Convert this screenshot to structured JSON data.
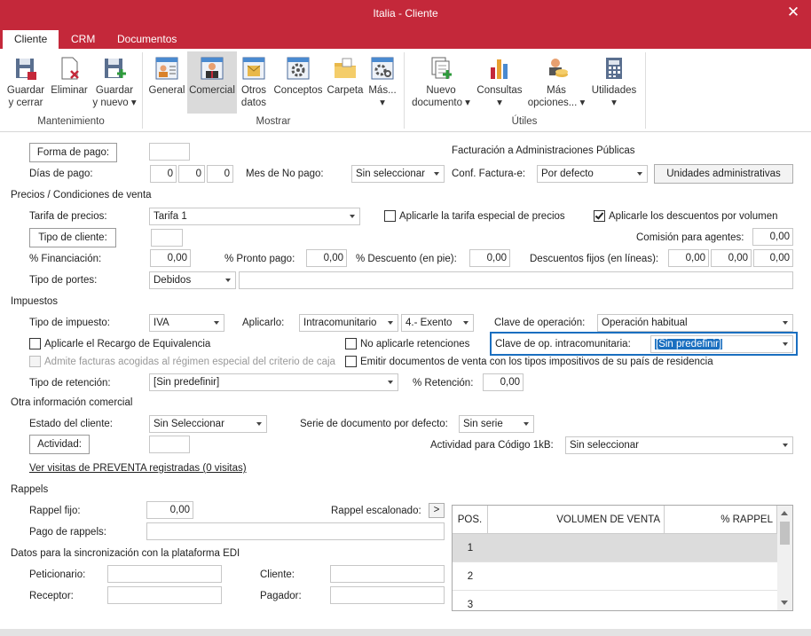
{
  "window": {
    "title": "Italia - Cliente",
    "close_glyph": "✕"
  },
  "tabs": [
    {
      "label": "Cliente",
      "active": true
    },
    {
      "label": "CRM",
      "active": false
    },
    {
      "label": "Documentos",
      "active": false
    }
  ],
  "ribbon": {
    "buttons": {
      "guardar_cerrar": [
        "Guardar",
        "y cerrar"
      ],
      "eliminar": [
        "Eliminar",
        ""
      ],
      "guardar_nuevo": [
        "Guardar",
        "y nuevo ▾"
      ],
      "general": [
        "General",
        ""
      ],
      "comercial": [
        "Comercial",
        ""
      ],
      "otros": [
        "Otros",
        "datos"
      ],
      "conceptos": [
        "Conceptos",
        ""
      ],
      "carpeta": [
        "Carpeta",
        ""
      ],
      "mas": [
        "Más...",
        "▾"
      ],
      "nuevo_doc": [
        "Nuevo",
        "documento ▾"
      ],
      "consultas": [
        "Consultas",
        "▾"
      ],
      "mas_opciones": [
        "Más",
        "opciones... ▾"
      ],
      "utilidades": [
        "Utilidades",
        "▾"
      ]
    },
    "groups": {
      "mantenimiento": "Mantenimiento",
      "mostrar": "Mostrar",
      "utiles": "Útiles"
    }
  },
  "form": {
    "forma_pago_btn": "Forma de pago:",
    "dias_pago_label": "Días de pago:",
    "dias_pago": [
      "0",
      "0",
      "0"
    ],
    "mes_no_pago_label": "Mes de No pago:",
    "mes_no_pago": "Sin seleccionar",
    "facturacion_title": "Facturación a Administraciones Públicas",
    "conf_factura_label": "Conf. Factura-e:",
    "conf_factura": "Por defecto",
    "unidades_btn": "Unidades administrativas",
    "precios_section": "Precios / Condiciones de venta",
    "tarifa_label": "Tarifa de precios:",
    "tarifa": "Tarifa 1",
    "chk_tarifa_especial": "Aplicarle la tarifa especial de precios",
    "chk_descuentos_volumen": "Aplicarle los descuentos por volumen",
    "tipo_cliente_btn": "Tipo de cliente:",
    "comision_label": "Comisión para agentes:",
    "comision": "0,00",
    "financiacion_label": "% Financiación:",
    "financiacion": "0,00",
    "pronto_pago_label": "% Pronto pago:",
    "pronto_pago": "0,00",
    "descuento_pie_label": "% Descuento (en pie):",
    "descuento_pie": "0,00",
    "descuentos_fijos_label": "Descuentos fijos (en líneas):",
    "descuentos_fijos": [
      "0,00",
      "0,00",
      "0,00"
    ],
    "tipo_portes_label": "Tipo de portes:",
    "tipo_portes": "Debidos",
    "impuestos_section": "Impuestos",
    "tipo_impuesto_label": "Tipo de impuesto:",
    "tipo_impuesto": "IVA",
    "aplicarlo_label": "Aplicarlo:",
    "aplicarlo": "Intracomunitario",
    "exento": "4.- Exento",
    "clave_operacion_label": "Clave de operación:",
    "clave_operacion": "Operación habitual",
    "chk_recargo": "Aplicarle el Recargo de Equivalencia",
    "chk_no_retenciones": "No aplicarle retenciones",
    "clave_intra_label": "Clave de op. intracomunitaria:",
    "clave_intra": "[Sin predefinir]",
    "chk_admite_facturas": "Admite facturas acogidas al régimen especial del criterio de caja",
    "chk_emitir_docs": "Emitir documentos de venta con los tipos impositivos de su país de residencia",
    "tipo_retencion_label": "Tipo de retención:",
    "tipo_retencion": "[Sin predefinir]",
    "retencion_label": "% Retención:",
    "retencion": "0,00",
    "otra_info_section": "Otra información comercial",
    "estado_label": "Estado del cliente:",
    "estado": "Sin Seleccionar",
    "serie_label": "Serie de documento por defecto:",
    "serie": "Sin serie",
    "actividad_btn": "Actividad:",
    "actividad_codigo_label": "Actividad para Código 1kB:",
    "actividad_codigo": "Sin seleccionar",
    "visitas_link": "Ver visitas de PREVENTA registradas (0 visitas)",
    "rappels_section": "Rappels",
    "rappel_fijo_label": "Rappel fijo:",
    "rappel_fijo": "0,00",
    "rappel_escalonado_label": "Rappel escalonado:",
    "rappel_escalonado_btn": ">",
    "pago_rappels_label": "Pago de rappels:",
    "edi_section": "Datos para la sincronización con la plataforma EDI",
    "peticionario_label": "Peticionario:",
    "cliente_label": "Cliente:",
    "receptor_label": "Receptor:",
    "pagador_label": "Pagador:"
  },
  "rappel_grid": {
    "headers": [
      "POS.",
      "VOLUMEN DE VENTA",
      "% RAPPEL"
    ],
    "rows": [
      "1",
      "2",
      "3"
    ]
  },
  "colors": {
    "accent": "#c4283a",
    "focus": "#1a6fc0"
  }
}
